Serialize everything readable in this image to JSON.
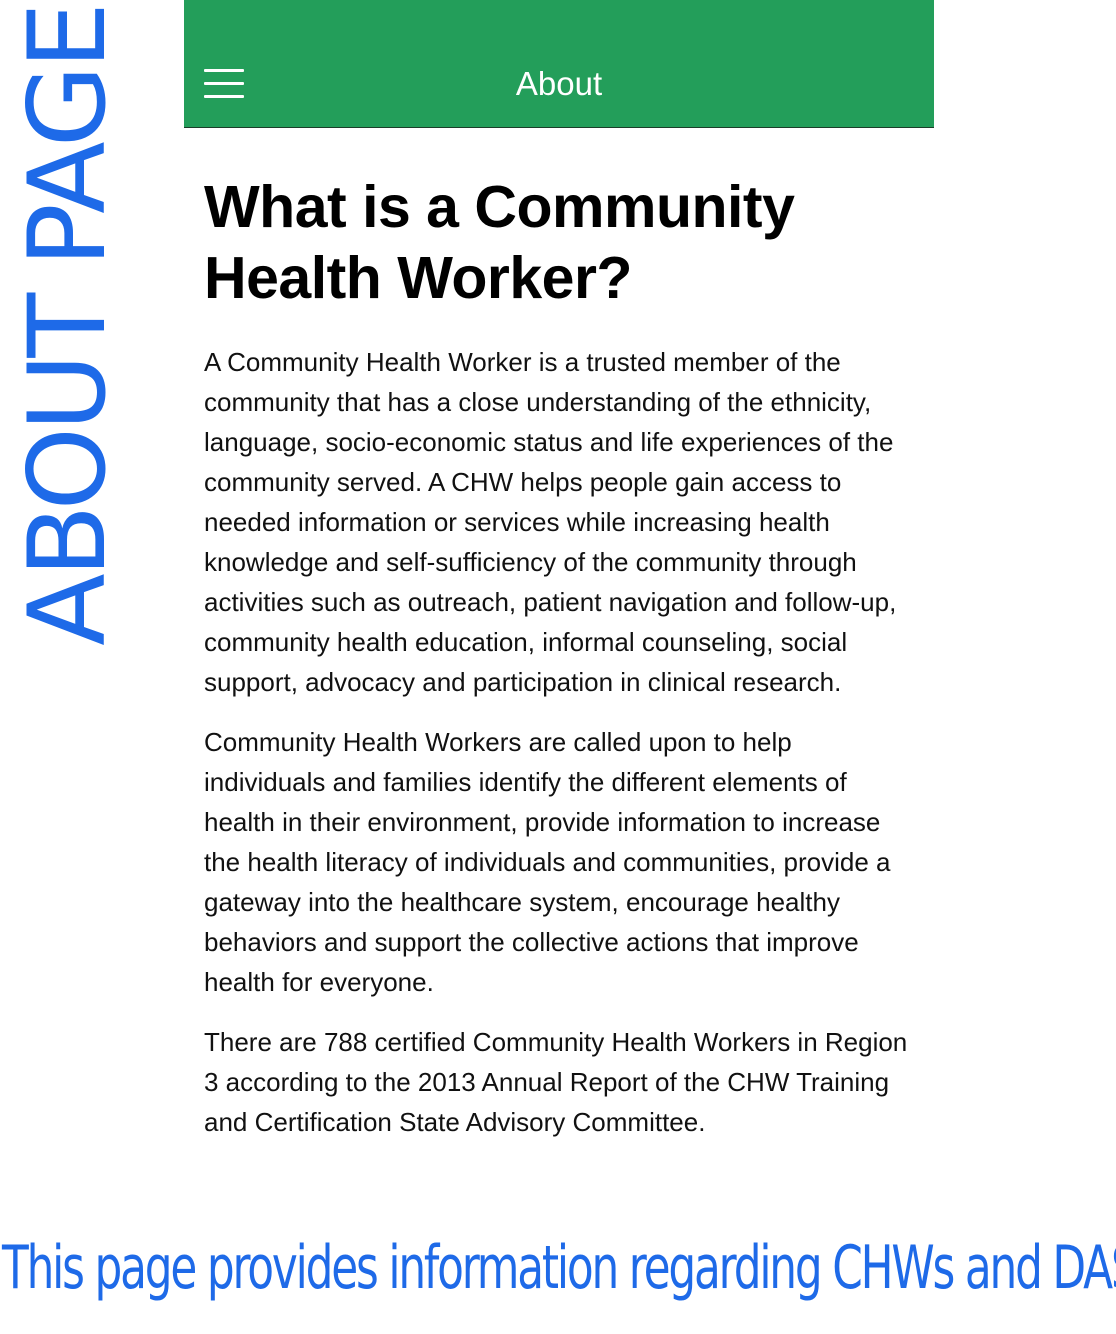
{
  "annotations": {
    "side_label": "ABOUT PAGE",
    "caption": "This page provides information regarding CHWs and DASH."
  },
  "header": {
    "title": "About",
    "menu_icon": "hamburger-menu-icon",
    "background_color": "#239e5a"
  },
  "article": {
    "heading": "What is a Community Health Worker?",
    "paragraphs": [
      "A Community Health Worker is a trusted member of the community that has a close understanding of the ethnicity, language, socio-economic status and life experiences of the community served. A CHW helps people gain access to needed information or services while increasing health knowledge and self-sufficiency of the community through activities such as outreach, patient navigation and follow-up, community health education, informal counseling, social support, advocacy and participation in clinical research.",
      "Community Health Workers are called upon to help individuals and families identify the different elements of health in their environment, provide information to increase the health literacy of individuals and communities, provide a gateway into the healthcare system, encourage healthy behaviors and support the collective actions that improve health for everyone.",
      "There are 788 certified Community Health Workers in Region 3 according to the 2013 Annual Report of the CHW Training and Certification State Advisory Committee."
    ]
  },
  "colors": {
    "annotation": "#1e6ae8",
    "header": "#239e5a"
  }
}
